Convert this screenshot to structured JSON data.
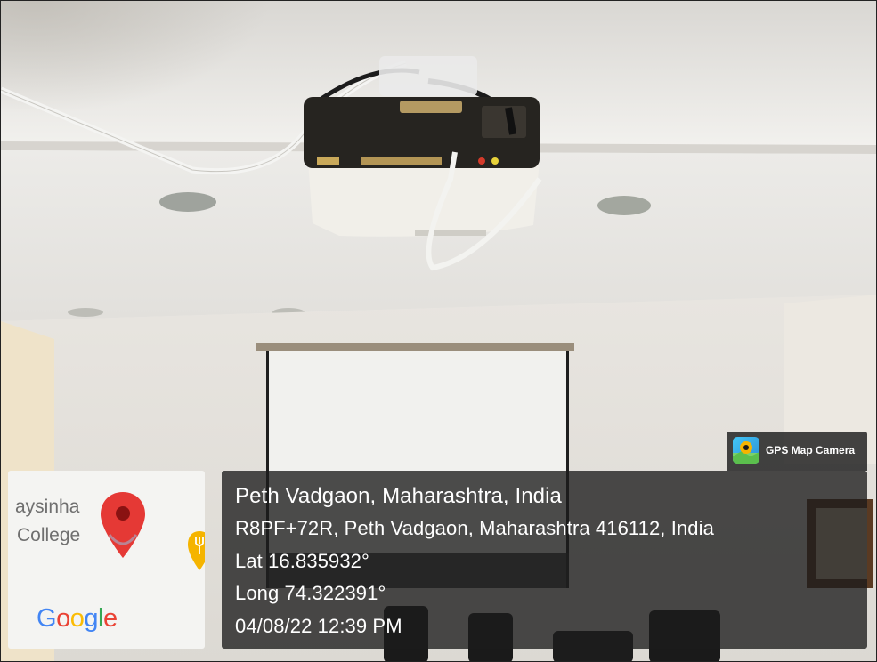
{
  "overlay": {
    "badge_text": "GPS Map Camera",
    "badge_icon": "map-pin-app-icon",
    "title": "Peth Vadgaon, Maharashtra, India",
    "address": "R8PF+72R, Peth Vadgaon, Maharashtra 416112, India",
    "latitude": "Lat 16.835932°",
    "longitude": "Long 74.322391°",
    "datetime": "04/08/22 12:39 PM"
  },
  "map": {
    "label_line1": "aysinha",
    "label_line2": "College",
    "brand": [
      "G",
      "o",
      "o",
      "g",
      "l",
      "e"
    ],
    "brand_colors": [
      "#4285F4",
      "#EA4335",
      "#FBBC05",
      "#4285F4",
      "#34A853",
      "#EA4335"
    ],
    "pin_color": "#E53935",
    "poi_color": "#F5B400"
  }
}
